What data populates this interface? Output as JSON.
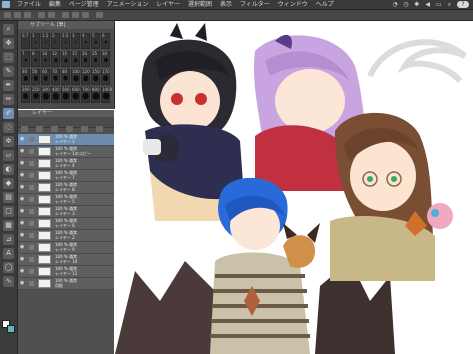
{
  "menu": {
    "items": [
      "ファイル",
      "編集",
      "ページ管理",
      "アニメーション",
      "レイヤー",
      "選択範囲",
      "表示",
      "フィルター",
      "ウィンドウ",
      "ヘルプ"
    ],
    "status_badge": "?"
  },
  "subtool_palette": {
    "title": "サブツール [筆]",
    "brush_sizes": [
      "0.7",
      "1",
      "1.5",
      "2",
      "2.5",
      "3",
      "4",
      "5",
      "6",
      "7",
      "8",
      "10",
      "12",
      "15",
      "17",
      "20",
      "25",
      "30",
      "40",
      "50",
      "60",
      "70",
      "80",
      "100",
      "120",
      "150",
      "170",
      "200",
      "250",
      "300",
      "400",
      "500",
      "600",
      "700",
      "800",
      "1000"
    ]
  },
  "layer_palette": {
    "title": "レイヤー",
    "layers": [
      {
        "blend": "100 % 通常",
        "name": "レイヤー 1"
      },
      {
        "blend": "100 % 通常",
        "name": "レイヤー 1のコピー"
      },
      {
        "blend": "100 % 通常",
        "name": "レイヤー 4"
      },
      {
        "blend": "100 % 通常",
        "name": "レイヤー 7"
      },
      {
        "blend": "100 % 通常",
        "name": "レイヤー 8"
      },
      {
        "blend": "100 % 通常",
        "name": "レイヤー 5"
      },
      {
        "blend": "100 % 通常",
        "name": "レイヤー 3"
      },
      {
        "blend": "100 % 通常",
        "name": "レイヤー 6"
      },
      {
        "blend": "100 % 通常",
        "name": "レイヤー 2"
      },
      {
        "blend": "100 % 通常",
        "name": "レイヤー 9"
      },
      {
        "blend": "100 % 通常",
        "name": "レイヤー 10"
      },
      {
        "blend": "100 % 通常",
        "name": "レイヤー 11"
      },
      {
        "blend": "100 % 通常",
        "name": "用紙"
      }
    ]
  },
  "colors": {
    "main_color": "#ffffff",
    "sub_color": "#62b7c9"
  }
}
